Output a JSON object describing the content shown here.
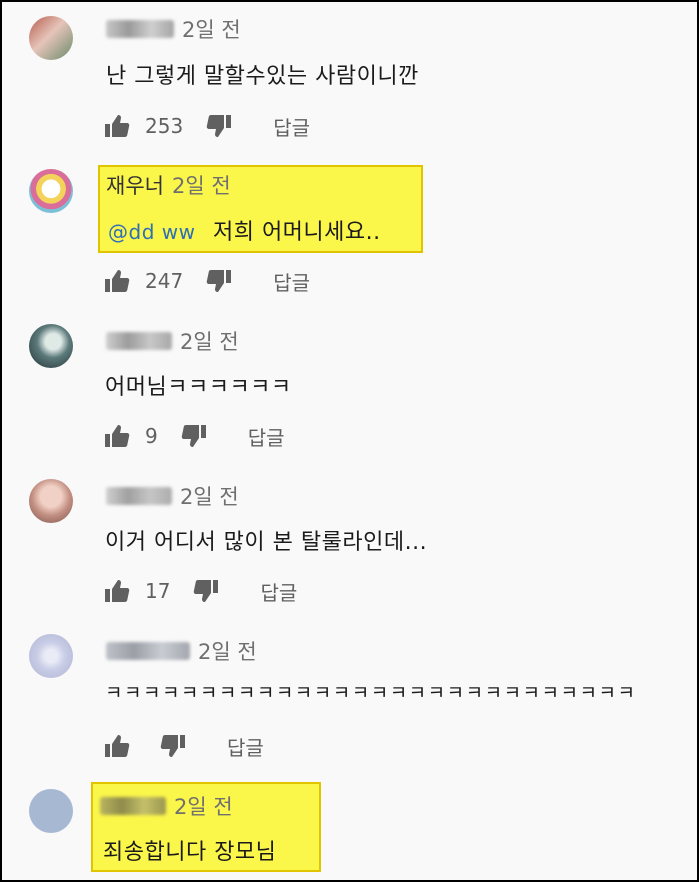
{
  "comments": [
    {
      "author": "박정미",
      "time": "2일 전",
      "text": "난 그렇게 말할수있는 사람이니깐",
      "likes": "253",
      "reply": "답글",
      "avatar_color": "#c99088"
    },
    {
      "author": "재우너",
      "time": "2일 전",
      "mention": "@dd ww",
      "text": "저희 어머니세요..",
      "likes": "247",
      "reply": "답글",
      "avatar_color": "#e8b64b",
      "highlight_color": "#fbf64a"
    },
    {
      "author": "정현철",
      "time": "2일 전",
      "text": "어머님ㅋㅋㅋㅋㅋㅋ",
      "likes": "9",
      "reply": "답글",
      "avatar_color": "#4e6b6c"
    },
    {
      "author": "문정호",
      "time": "2일 전",
      "text": "이거 어디서 많이 본 탈룰라인데...",
      "likes": "17",
      "reply": "답글",
      "avatar_color": "#d8a59a"
    },
    {
      "author": "rwreqwe",
      "time": "2일 전",
      "text": "ㅋㅋㅋㅋㅋㅋㅋㅋㅋㅋㅋㅋㅋㅋㅋㅋㅋㅋㅋㅋㅋㅋㅋㅋㅋㅋㅋㅋ",
      "likes": "",
      "reply": "답글",
      "avatar_color": "#c9cde6"
    },
    {
      "author": "생생 ww",
      "time": "2일 전",
      "text": "죄송합니다 장모님",
      "avatar_color": "#a7b8d3",
      "highlight_color": "#fbf64a"
    }
  ]
}
